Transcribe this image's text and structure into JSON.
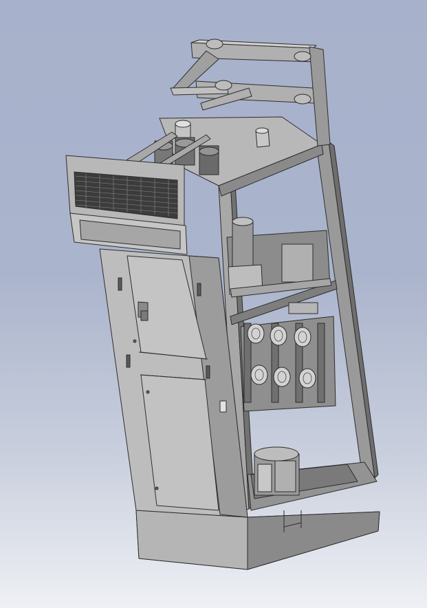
{
  "viewport": {
    "background_top": "#a7b1cb",
    "background_bottom": "#eef0f4"
  },
  "model": {
    "subject": "switchgear-cabinet",
    "body_color": "#a2a2a2",
    "light_face_color": "#c4c4c4",
    "dark_face_color": "#6e6e6e",
    "edge_color": "#2c2c2c",
    "insulator_phase_count": 3,
    "breaker_pole_count": 3
  }
}
